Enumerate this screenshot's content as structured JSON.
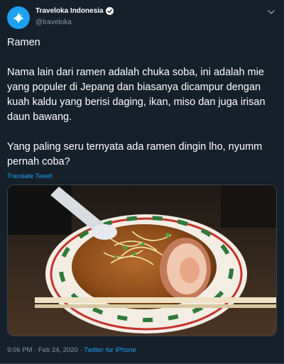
{
  "tweet": {
    "author_name": "Traveloka Indonesia",
    "author_handle": "@traveloka",
    "paragraphs": [
      "Ramen",
      "Nama lain dari ramen adalah chuka soba, ini adalah mie yang populer di Jepang dan biasanya dicampur dengan kuah kaldu yang berisi daging, ikan, miso dan juga irisan daun bawang.",
      "Yang paling seru ternyata ada ramen dingin lho, nyumm pernah coba?"
    ],
    "translate_label": "Translate Tweet",
    "timestamp": "9:06 PM · Feb 24, 2020",
    "separator": " · ",
    "source": "Twitter for iPhone"
  },
  "icons": {
    "avatar": "traveloka-bird-logo",
    "verified": "verified-badge-icon",
    "menu": "chevron-down-icon"
  },
  "colors": {
    "background": "#15202b",
    "accent": "#1da1f2",
    "secondary_text": "#8899a6"
  }
}
